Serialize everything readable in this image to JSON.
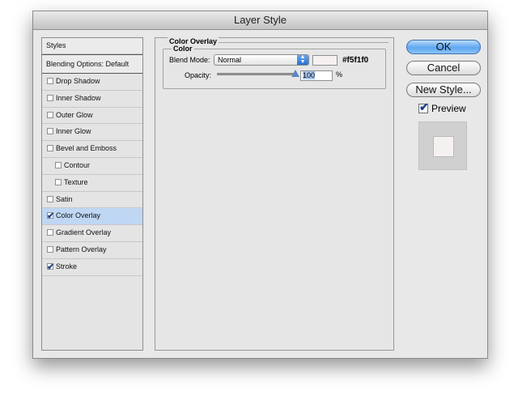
{
  "window": {
    "title": "Layer Style"
  },
  "styles_list": {
    "header": "Styles",
    "blending_options": "Blending Options: Default",
    "items": [
      {
        "label": "Drop Shadow",
        "checked": false,
        "indent": false,
        "selected": false
      },
      {
        "label": "Inner Shadow",
        "checked": false,
        "indent": false,
        "selected": false
      },
      {
        "label": "Outer Glow",
        "checked": false,
        "indent": false,
        "selected": false
      },
      {
        "label": "Inner Glow",
        "checked": false,
        "indent": false,
        "selected": false
      },
      {
        "label": "Bevel and Emboss",
        "checked": false,
        "indent": false,
        "selected": false
      },
      {
        "label": "Contour",
        "checked": false,
        "indent": true,
        "selected": false
      },
      {
        "label": "Texture",
        "checked": false,
        "indent": true,
        "selected": false
      },
      {
        "label": "Satin",
        "checked": false,
        "indent": false,
        "selected": false
      },
      {
        "label": "Color Overlay",
        "checked": true,
        "indent": false,
        "selected": true
      },
      {
        "label": "Gradient Overlay",
        "checked": false,
        "indent": false,
        "selected": false
      },
      {
        "label": "Pattern Overlay",
        "checked": false,
        "indent": false,
        "selected": false
      },
      {
        "label": "Stroke",
        "checked": true,
        "indent": false,
        "selected": false
      }
    ]
  },
  "color_overlay": {
    "section_title": "Color Overlay",
    "group_title": "Color",
    "blend_mode_label": "Blend Mode:",
    "blend_mode_value": "Normal",
    "color_hex": "#f5f1f0",
    "opacity_label": "Opacity:",
    "opacity_value": "100",
    "opacity_unit": "%"
  },
  "buttons": {
    "ok": "OK",
    "cancel": "Cancel",
    "new_style": "New Style..."
  },
  "preview": {
    "label": "Preview",
    "checked": true
  },
  "colors": {
    "overlay_color": "#f5f1f0",
    "selected_row": "#bfd7f3",
    "primary_button": "#5ea7f1"
  }
}
